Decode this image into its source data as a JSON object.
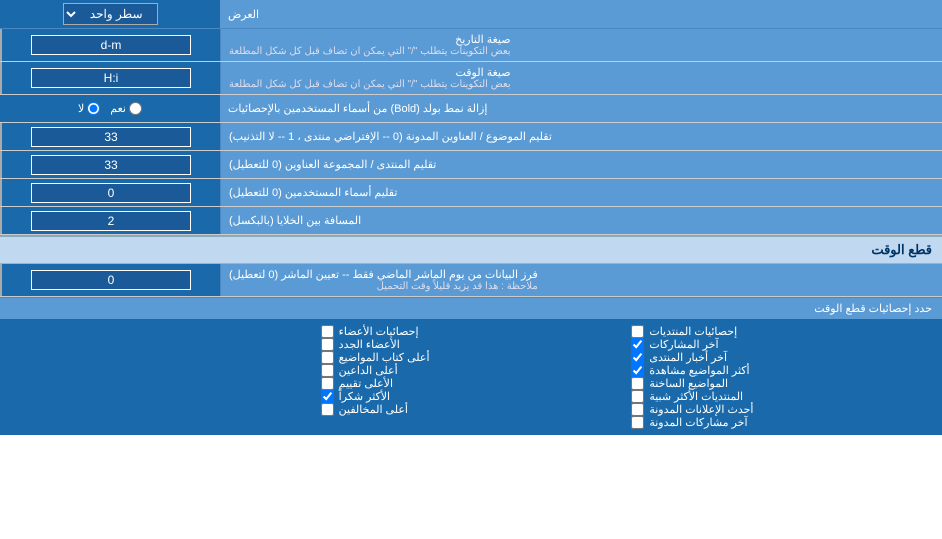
{
  "header": {
    "display_label": "العرض",
    "display_select_default": "سطر واحد"
  },
  "date_format": {
    "label": "صيغة التاريخ",
    "sublabel": "بعض التكوينات يتطلب \"/\" التي يمكن ان تضاف قبل كل شكل المطلعة",
    "value": "d-m"
  },
  "time_format": {
    "label": "صيغة الوقت",
    "sublabel": "بعض التكوينات يتطلب \"/\" التي يمكن ان تضاف قبل كل شكل المطلعة",
    "value": "H:i"
  },
  "bold_remove": {
    "label": "إزالة نمط بولد (Bold) من أسماء المستخدمين بالإحصائيات",
    "option_yes": "نعم",
    "option_no": "لا",
    "selected": "no"
  },
  "topic_address": {
    "label": "تقليم الموضوع / العناوين المدونة (0 -- الإفتراضي منتدى ، 1 -- لا التذنيب)",
    "value": "33"
  },
  "forum_address": {
    "label": "تقليم المنتدى / المجموعة العناوين (0 للتعطيل)",
    "value": "33"
  },
  "usernames": {
    "label": "تقليم أسماء المستخدمين (0 للتعطيل)",
    "value": "0"
  },
  "cell_spacing": {
    "label": "المسافة بين الخلايا (بالبكسل)",
    "value": "2"
  },
  "realtime_section": {
    "title": "قطع الوقت"
  },
  "realtime_filter": {
    "label": "فرز البيانات من يوم الماشر الماضي فقط -- تعيين الماشر (0 لتعطيل)",
    "note": "ملاحظة : هذا قد يزيد قليلاً وقت التحميل",
    "value": "0"
  },
  "stats_section": {
    "title": "حدد إحصائيات قطع الوقت"
  },
  "checkboxes_col1": [
    {
      "label": "إحصائيات المنتديات",
      "checked": false
    },
    {
      "label": "آخر المشاركات",
      "checked": true
    },
    {
      "label": "آخر أخبار المنتدى",
      "checked": true
    },
    {
      "label": "أكثر المواضيع مشاهدة",
      "checked": true
    },
    {
      "label": "المواضيع الساخنة",
      "checked": false
    },
    {
      "label": "المنتديات الأكثر شبية",
      "checked": false
    },
    {
      "label": "أحدث الإعلانات المدونة",
      "checked": false
    },
    {
      "label": "آخر مشاركات المدونة",
      "checked": false
    }
  ],
  "checkboxes_col2": [
    {
      "label": "إحصائيات الأعضاء",
      "checked": false
    },
    {
      "label": "الأعضاء الجدد",
      "checked": false
    },
    {
      "label": "أعلى كتاب المواضيع",
      "checked": false
    },
    {
      "label": "أعلى الداعين",
      "checked": false
    },
    {
      "label": "الأعلى تقييم",
      "checked": false
    },
    {
      "label": "الأكثر شكراً",
      "checked": true
    },
    {
      "label": "أعلى المخالفين",
      "checked": false
    }
  ],
  "icons": {
    "dropdown": "▼",
    "radio_on": "●",
    "radio_off": "○"
  }
}
